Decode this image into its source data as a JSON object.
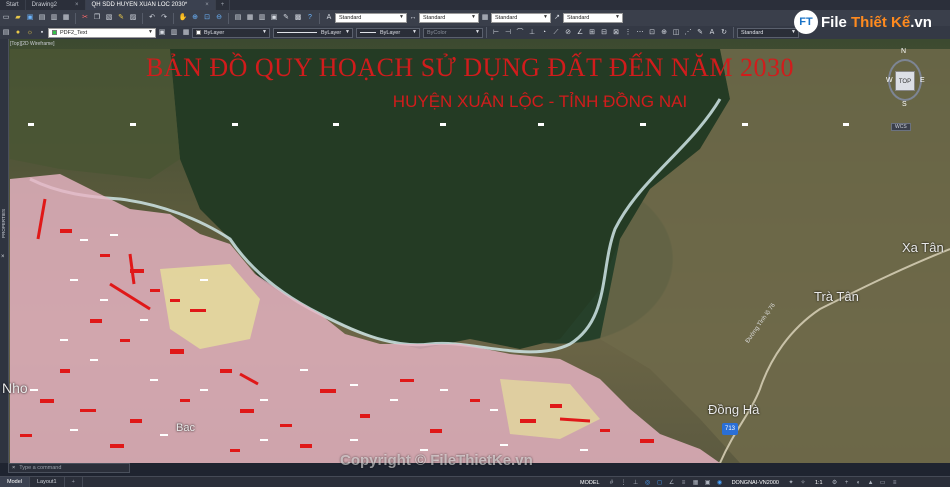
{
  "tabs": [
    {
      "label": "Start",
      "active": false
    },
    {
      "label": "Drawing2",
      "active": false
    },
    {
      "label": "QH SDD HUYEN XUAN LOC 2030*",
      "active": true
    }
  ],
  "tab_close": "×",
  "tab_add": "+",
  "toolbar": {
    "style_combos": [
      {
        "value": "Standard",
        "icon": "text-style-icon"
      },
      {
        "value": "Standard",
        "icon": "dimension-style-icon"
      },
      {
        "value": "Standard",
        "icon": "table-style-icon"
      },
      {
        "value": "Standard",
        "icon": "multileader-style-icon"
      }
    ],
    "layer_value": "PDF2_Text",
    "color_value": "ByLayer",
    "linetype_value": "ByLayer",
    "lineweight_value": "ByLayer",
    "plotstyle_value": "ByColor",
    "right_combo": "Standard"
  },
  "viewport_label": "[Top][2D Wireframe]",
  "map": {
    "title": "BẢN ĐỒ QUY HOẠCH SỬ DỤNG ĐẤT ĐẾN NĂM 2030",
    "subtitle": "HUYỆN XUÂN LỘC - TỈNH ĐỒNG NAI",
    "places": {
      "xa_tan": "Xa Tân",
      "tra_tan": "Trà Tân",
      "dong_ha": "Đồng Hà",
      "nho": "Nho",
      "bac": "Bac"
    },
    "road_label": "Đường Tỉnh lộ 76",
    "shield": "713",
    "colors": {
      "title_red": "#d11c1c",
      "land_use_pink": "#e8b4c4",
      "land_use_yellow": "#e6e09a",
      "river": "#cfe5e6",
      "forest": "#243b24"
    }
  },
  "nav": {
    "north": "N",
    "south": "S",
    "east": "E",
    "west": "W",
    "cube": "TOP",
    "wcs": "WCS"
  },
  "logo": {
    "mark": "FT",
    "text_a": "File",
    "text_b": "Thiết Kế",
    "text_c": ".vn"
  },
  "palette": {
    "label": "PROPERTIES",
    "close": "×"
  },
  "command": {
    "prompt": "×",
    "placeholder": "Type a command"
  },
  "watermark": "Copyright © FileThietKe.vn",
  "status": {
    "layout_tabs": [
      {
        "label": "Model",
        "active": true
      },
      {
        "label": "Layout1",
        "active": false
      }
    ],
    "layout_add": "+",
    "space": "MODEL",
    "coordinate_system": "DONGNAI-VN2000",
    "scale": "1:1"
  }
}
